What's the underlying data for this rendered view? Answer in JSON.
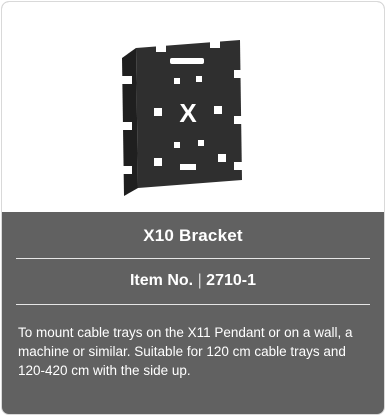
{
  "product": {
    "image_icon": "bracket-product-image",
    "image_mark": "X",
    "title": "X10 Bracket",
    "item_label": "Item No.",
    "item_separator": "|",
    "item_number": "2710-1",
    "description": "To mount cable trays on the X11 Pendant or on a wall, a machine or similar. Suitable for 120 cm cable trays and 120-420 cm with the side up."
  },
  "colors": {
    "card_background": "#616161",
    "image_background": "#ffffff",
    "text": "#ffffff",
    "bracket": "#3a3a3a"
  }
}
